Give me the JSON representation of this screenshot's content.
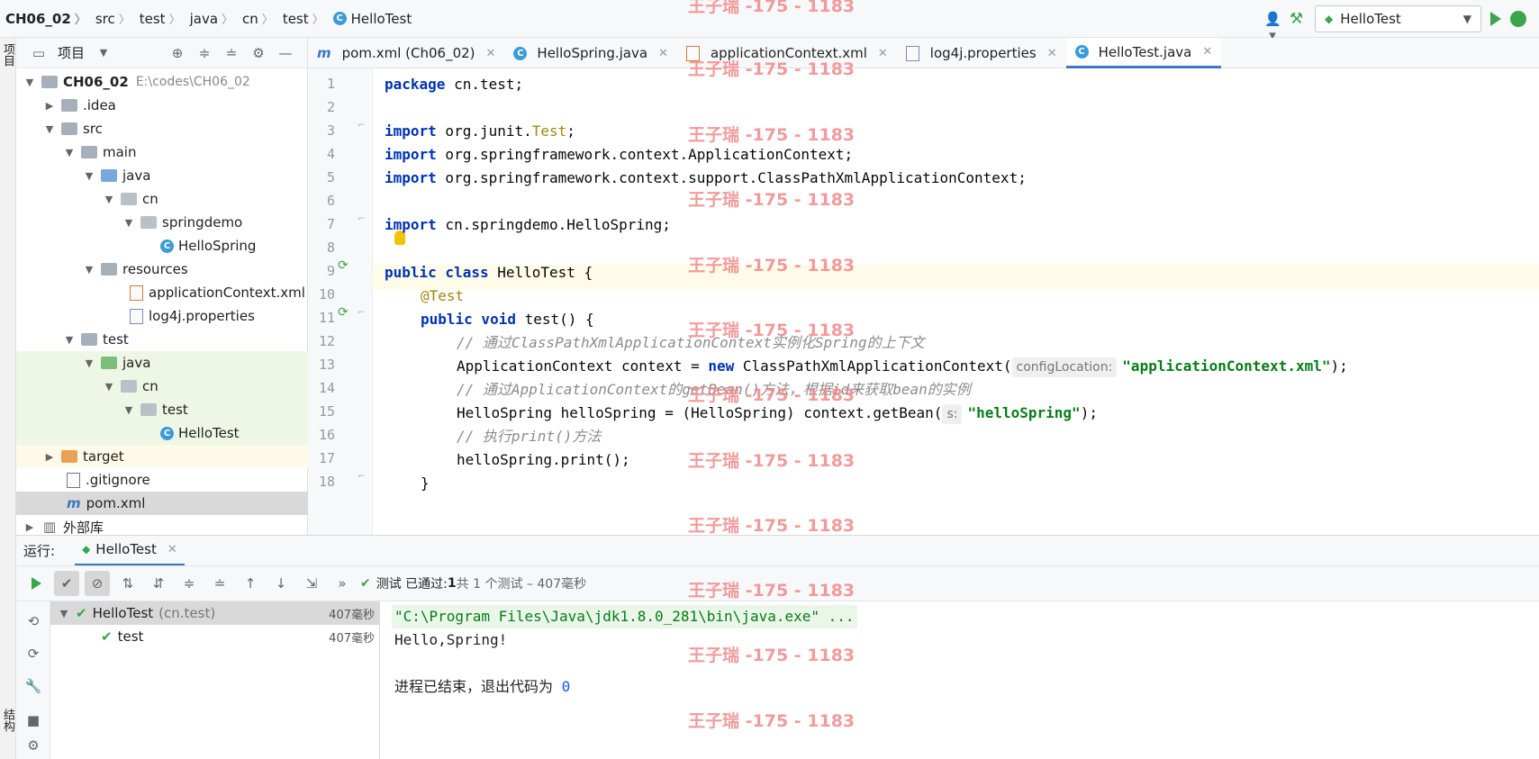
{
  "navbar": {
    "crumbs": [
      "CH06_02",
      "src",
      "test",
      "java",
      "cn",
      "test",
      "HelloTest"
    ],
    "run_config": "HelloTest"
  },
  "left_strip": {
    "project_tab": "项目",
    "structure_tab": "结构"
  },
  "project": {
    "title": "项目",
    "tree": [
      {
        "label": "CH06_02",
        "hint": "E:\\codes\\CH06_02"
      },
      {
        "label": ".idea"
      },
      {
        "label": "src"
      },
      {
        "label": "main"
      },
      {
        "label": "java"
      },
      {
        "label": "cn"
      },
      {
        "label": "springdemo"
      },
      {
        "label": "HelloSpring"
      },
      {
        "label": "resources"
      },
      {
        "label": "applicationContext.xml"
      },
      {
        "label": "log4j.properties"
      },
      {
        "label": "test"
      },
      {
        "label": "java"
      },
      {
        "label": "cn"
      },
      {
        "label": "test"
      },
      {
        "label": "HelloTest"
      },
      {
        "label": "target"
      },
      {
        "label": ".gitignore"
      },
      {
        "label": "pom.xml"
      },
      {
        "label": "外部库"
      }
    ]
  },
  "tabs": [
    {
      "label": "pom.xml (Ch06_02)"
    },
    {
      "label": "HelloSpring.java"
    },
    {
      "label": "applicationContext.xml"
    },
    {
      "label": "log4j.properties"
    },
    {
      "label": "HelloTest.java"
    }
  ],
  "editor": {
    "line_numbers": [
      "1",
      "2",
      "3",
      "4",
      "5",
      "6",
      "7",
      "8",
      "9",
      "10",
      "11",
      "12",
      "13",
      "14",
      "15",
      "16",
      "17",
      "18"
    ],
    "code": {
      "l1_kw": "package",
      "l1_rest": " cn.test;",
      "l3_kw": "import",
      "l3_a": " org.junit.",
      "l3_b": "Test",
      "l3_c": ";",
      "l4_kw": "import",
      "l4_rest": " org.springframework.context.ApplicationContext;",
      "l5_kw": "import",
      "l5_rest": " org.springframework.context.support.ClassPathXmlApplicationContext;",
      "l7_kw": "import",
      "l7_rest": " cn.springdemo.HelloSpring;",
      "l9_kw": "public class",
      "l9_rest": " HelloTest {",
      "l10": "@Test",
      "l11_kw": "public void",
      "l11_rest": " test() {",
      "l12": "// 通过ClassPathXmlApplicationContext实例化Spring的上下文",
      "l13_a": "ApplicationContext context = ",
      "l13_kw": "new",
      "l13_b": " ClassPathXmlApplicationContext(",
      "l13_hint": "configLocation:",
      "l13_str": "\"applicationContext.xml\"",
      "l13_c": ");",
      "l14": "// 通过ApplicationContext的getBean()方法，根据id来获取bean的实例",
      "l15_a": "HelloSpring helloSpring = (HelloSpring) context.getBean(",
      "l15_hint": "s:",
      "l15_str": "\"helloSpring\"",
      "l15_c": ");",
      "l16": "// 执行print()方法",
      "l17": "helloSpring.print();",
      "l18": "}"
    }
  },
  "run": {
    "label": "运行:",
    "tab": "HelloTest",
    "status_prefix": "测试 已通过: ",
    "status_count": "1",
    "status_suffix": "共 1 个测试 – 407毫秒",
    "tests": [
      {
        "name": "HelloTest",
        "pkg": "(cn.test)",
        "time": "407毫秒"
      },
      {
        "name": "test",
        "time": "407毫秒"
      }
    ],
    "console": {
      "cmd": "\"C:\\Program Files\\Java\\jdk1.8.0_281\\bin\\java.exe\" ...",
      "out": "Hello,Spring!",
      "exit_text": "进程已结束，退出代码为 ",
      "exit_code": "0"
    }
  },
  "watermark": "王子瑞 -175 - 1183",
  "colors": {
    "keyword": "#0033b3",
    "string": "#067d17",
    "annotation": "#9e880d",
    "comment": "#8c8c8c",
    "pass": "#3aa54d",
    "watermark": "#f08a8a"
  }
}
